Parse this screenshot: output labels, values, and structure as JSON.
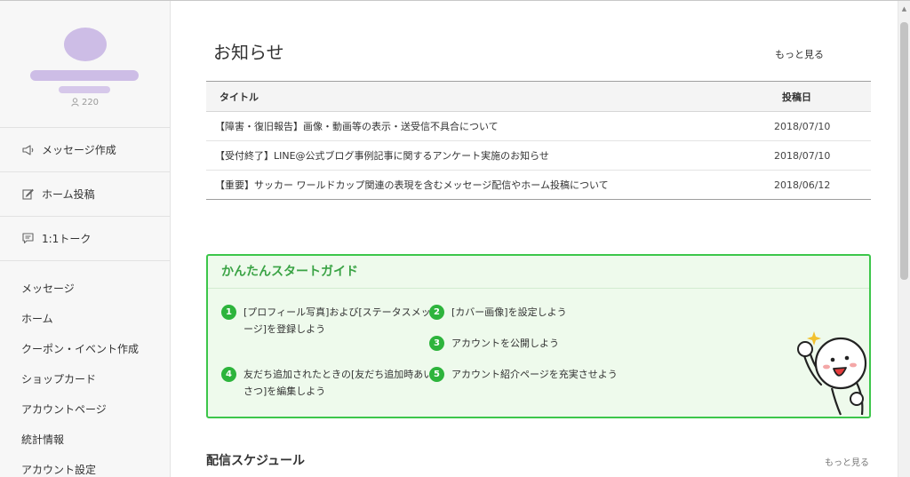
{
  "sidebar": {
    "followers_count": "220",
    "actions": [
      {
        "icon": "megaphone-icon",
        "label": "メッセージ作成"
      },
      {
        "icon": "edit-icon",
        "label": "ホーム投稿"
      },
      {
        "icon": "chat-icon",
        "label": "1:1トーク"
      }
    ],
    "nav": [
      "メッセージ",
      "ホーム",
      "クーポン・イベント作成",
      "ショップカード",
      "アカウントページ",
      "統計情報",
      "アカウント設定"
    ]
  },
  "news": {
    "title": "お知らせ",
    "more_label": "もっと見る",
    "columns": {
      "title": "タイトル",
      "date": "投稿日"
    },
    "rows": [
      {
        "title": "【障害・復旧報告】画像・動画等の表示・送受信不具合について",
        "date": "2018/07/10"
      },
      {
        "title": "【受付終了】LINE@公式ブログ事例記事に関するアンケート実施のお知らせ",
        "date": "2018/07/10"
      },
      {
        "title": "【重要】サッカー ワールドカップ関連の表現を含むメッセージ配信やホーム投稿について",
        "date": "2018/06/12"
      }
    ]
  },
  "guide": {
    "title": "かんたんスタートガイド",
    "steps": [
      {
        "num": "1",
        "text": "[プロフィール写真]および[ステータスメッセ\nージ]を登録しよう"
      },
      {
        "num": "2",
        "text": "[カバー画像]を設定しよう"
      },
      {
        "num": "3",
        "text": "アカウントを公開しよう"
      },
      {
        "num": "4",
        "text": "友だち追加されたときの[友だち追加時あい\nさつ]を編集しよう"
      },
      {
        "num": "5",
        "text": "アカウント紹介ページを充実させよう"
      }
    ]
  },
  "schedule": {
    "title": "配信スケジュール",
    "more_label": "もっと見る"
  },
  "colors": {
    "accent_green": "#2db43c",
    "guide_border": "#3cc64a",
    "guide_bg": "#eefaec",
    "profile_blur": "#cdbde6"
  }
}
